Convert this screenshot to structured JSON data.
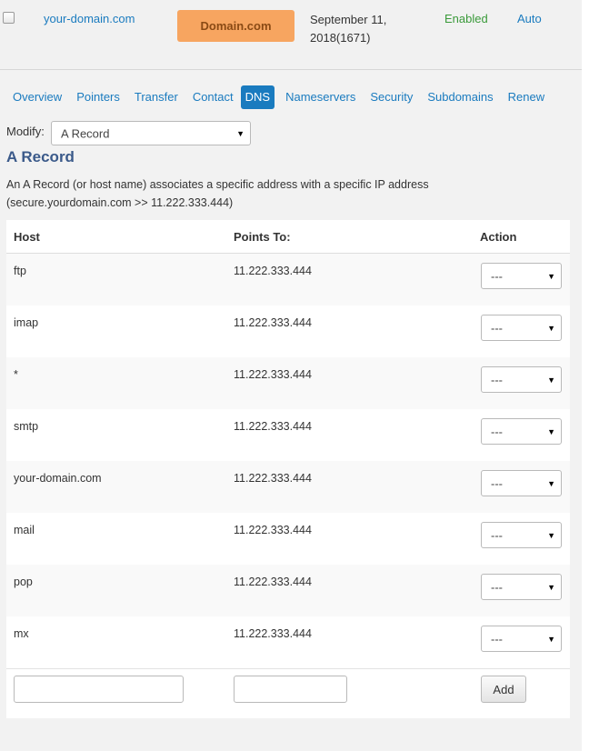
{
  "top_row": {
    "domain": "your-domain.com",
    "badge": "Domain.com",
    "date": "September 11, 2018(1671)",
    "status": "Enabled",
    "renew": "Auto"
  },
  "tabs": [
    {
      "label": "Overview"
    },
    {
      "label": "Pointers"
    },
    {
      "label": "Transfer"
    },
    {
      "label": "Contact"
    },
    {
      "label": "DNS",
      "active": true
    },
    {
      "label": "Nameservers"
    },
    {
      "label": "Security"
    },
    {
      "label": "Subdomains"
    },
    {
      "label": "Renew"
    }
  ],
  "modify": {
    "label": "Modify:",
    "selected": "A Record"
  },
  "section": {
    "title": "A Record",
    "description": "An A Record (or host name) associates a specific address with a specific IP address (secure.yourdomain.com >> 11.222.333.444)"
  },
  "table": {
    "headers": {
      "host": "Host",
      "points_to": "Points To:",
      "action": "Action"
    },
    "rows": [
      {
        "host": "ftp",
        "points_to": "11.222.333.444",
        "action": "---"
      },
      {
        "host": "imap",
        "points_to": "11.222.333.444",
        "action": "---"
      },
      {
        "host": "*",
        "points_to": "11.222.333.444",
        "action": "---"
      },
      {
        "host": "smtp",
        "points_to": "11.222.333.444",
        "action": "---"
      },
      {
        "host": "your-domain.com",
        "points_to": "11.222.333.444",
        "action": "---"
      },
      {
        "host": "mail",
        "points_to": "11.222.333.444",
        "action": "---"
      },
      {
        "host": "pop",
        "points_to": "11.222.333.444",
        "action": "---"
      },
      {
        "host": "mx",
        "points_to": "11.222.333.444",
        "action": "---"
      }
    ],
    "new_entry": {
      "host_value": "",
      "points_to_value": "",
      "add_label": "Add"
    }
  }
}
